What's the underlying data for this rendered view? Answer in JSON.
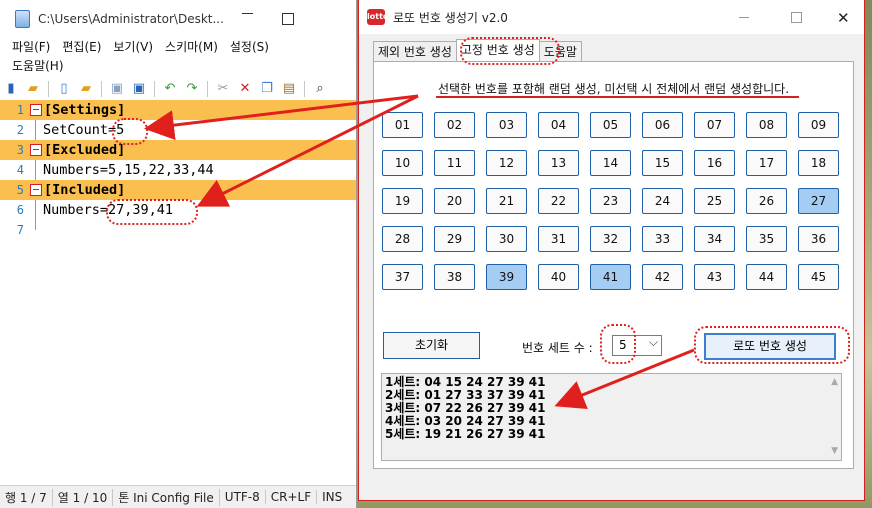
{
  "notepad": {
    "title": "C:\\Users\\Administrator\\Deskt...",
    "menu": [
      "파일(F)",
      "편집(E)",
      "보기(V)",
      "스키마(M)",
      "설정(S)",
      "도움말(H)"
    ],
    "lines": [
      {
        "num": "1",
        "text": "[Settings]",
        "section": true
      },
      {
        "num": "2",
        "text": "SetCount=5",
        "section": false
      },
      {
        "num": "3",
        "text": "[Excluded]",
        "section": true
      },
      {
        "num": "4",
        "text": "Numbers=5,15,22,33,44",
        "section": false
      },
      {
        "num": "5",
        "text": "[Included]",
        "section": true
      },
      {
        "num": "6",
        "text": "Numbers=27,39,41",
        "section": false
      },
      {
        "num": "7",
        "text": "",
        "section": false
      }
    ],
    "status": [
      "행 1 / 7",
      "열 1 / 10",
      "톤 Ini Config File",
      "UTF-8",
      "CR+LF",
      "INS"
    ],
    "highlight_color": "#fbbf4f"
  },
  "lotto": {
    "title": "로또 번호 생성기 v2.0",
    "icon_text": "lotto",
    "tabs": [
      "제외 번호 생성",
      "고정 번호 생성",
      "도움말"
    ],
    "active_tab": 1,
    "description": "선택한 번호를 포함해 랜덤 생성, 미선택 시 전체에서 랜덤 생성합니다.",
    "numbers": [
      "01",
      "02",
      "03",
      "04",
      "05",
      "06",
      "07",
      "08",
      "09",
      "10",
      "11",
      "12",
      "13",
      "14",
      "15",
      "16",
      "17",
      "18",
      "19",
      "20",
      "21",
      "22",
      "23",
      "24",
      "25",
      "26",
      "27",
      "28",
      "29",
      "30",
      "31",
      "32",
      "33",
      "34",
      "35",
      "36",
      "37",
      "38",
      "39",
      "40",
      "41",
      "42",
      "43",
      "44",
      "45"
    ],
    "selected": [
      "27",
      "39",
      "41"
    ],
    "reset_label": "초기화",
    "set_label": "번호 세트 수 :",
    "set_value": "5",
    "generate_label": "로또 번호 생성",
    "results": [
      "1세트: 04 15 24 27 39 41",
      "2세트: 01 27 33 37 39 41",
      "3세트: 07 22 26 27 39 41",
      "4세트: 03 20 24 27 39 41",
      "5세트: 19 21 26 27 39 41"
    ],
    "selected_color": "#a5cdf3",
    "annotation_color": "#e0201c"
  }
}
